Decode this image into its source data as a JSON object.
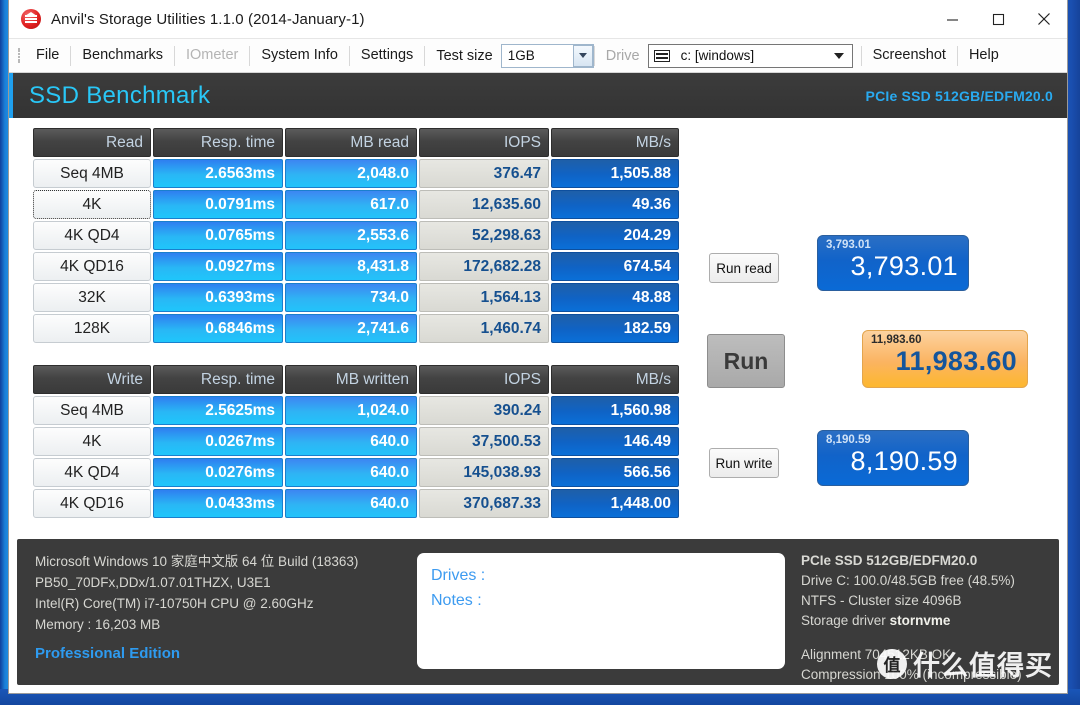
{
  "window": {
    "title": "Anvil's Storage Utilities 1.1.0 (2014-January-1)",
    "icon": "anvil-app-icon",
    "minimize": "minimize-icon",
    "maximize": "maximize-icon",
    "close": "close-icon"
  },
  "menu": {
    "items": [
      {
        "label": "File",
        "disabled": false
      },
      {
        "label": "Benchmarks",
        "disabled": false
      },
      {
        "label": "IOmeter",
        "disabled": true
      },
      {
        "label": "System Info",
        "disabled": false
      },
      {
        "label": "Settings",
        "disabled": false
      }
    ],
    "test_size_label": "Test size",
    "test_size_value": "1GB",
    "drive_label": "Drive",
    "drive_value": "c: [windows]",
    "screenshot_label": "Screenshot",
    "help_label": "Help"
  },
  "banner": {
    "title": "SSD Benchmark",
    "device": "PCIe SSD 512GB/EDFM20.0"
  },
  "read_table": {
    "headers": [
      "Read",
      "Resp. time",
      "MB read",
      "IOPS",
      "MB/s"
    ],
    "rows": [
      {
        "label": "Seq 4MB",
        "focus": false,
        "resp": "2.6563ms",
        "mb": "2,048.0",
        "iops": "376.47",
        "mbs": "1,505.88"
      },
      {
        "label": "4K",
        "focus": true,
        "resp": "0.0791ms",
        "mb": "617.0",
        "iops": "12,635.60",
        "mbs": "49.36"
      },
      {
        "label": "4K QD4",
        "focus": false,
        "resp": "0.0765ms",
        "mb": "2,553.6",
        "iops": "52,298.63",
        "mbs": "204.29"
      },
      {
        "label": "4K QD16",
        "focus": false,
        "resp": "0.0927ms",
        "mb": "8,431.8",
        "iops": "172,682.28",
        "mbs": "674.54"
      },
      {
        "label": "32K",
        "focus": false,
        "resp": "0.6393ms",
        "mb": "734.0",
        "iops": "1,564.13",
        "mbs": "48.88"
      },
      {
        "label": "128K",
        "focus": false,
        "resp": "0.6846ms",
        "mb": "2,741.6",
        "iops": "1,460.74",
        "mbs": "182.59"
      }
    ]
  },
  "write_table": {
    "headers": [
      "Write",
      "Resp. time",
      "MB written",
      "IOPS",
      "MB/s"
    ],
    "rows": [
      {
        "label": "Seq 4MB",
        "focus": false,
        "resp": "2.5625ms",
        "mb": "1,024.0",
        "iops": "390.24",
        "mbs": "1,560.98"
      },
      {
        "label": "4K",
        "focus": false,
        "resp": "0.0267ms",
        "mb": "640.0",
        "iops": "37,500.53",
        "mbs": "146.49"
      },
      {
        "label": "4K QD4",
        "focus": false,
        "resp": "0.0276ms",
        "mb": "640.0",
        "iops": "145,038.93",
        "mbs": "566.56"
      },
      {
        "label": "4K QD16",
        "focus": false,
        "resp": "0.0433ms",
        "mb": "640.0",
        "iops": "370,687.33",
        "mbs": "1,448.00"
      }
    ]
  },
  "controls": {
    "run_read": "Run read",
    "run": "Run",
    "run_write": "Run write"
  },
  "scores": {
    "read": {
      "mini": "3,793.01",
      "big": "3,793.01"
    },
    "total": {
      "mini": "11,983.60",
      "big": "11,983.60"
    },
    "write": {
      "mini": "8,190.59",
      "big": "8,190.59"
    }
  },
  "sysinfo": {
    "os": "Microsoft Windows 10 家庭中文版 64 位 Build (18363)",
    "board": "PB50_70DFx,DDx/1.07.01THZX, U3E1",
    "cpu": "Intel(R) Core(TM) i7-10750H CPU @ 2.60GHz",
    "memory": "Memory : 16,203 MB",
    "edition": "Professional Edition"
  },
  "notes": {
    "drives_label": "Drives :",
    "notes_label": "Notes :"
  },
  "driveinfo": {
    "device": "PCIe SSD 512GB/EDFM20.0",
    "capacity": "Drive C: 100.0/48.5GB free (48.5%)",
    "filesystem": "NTFS - Cluster size 4096B",
    "driver_label": "Storage driver",
    "driver_value": "stornvme",
    "alignment": "Alignment 704512KB OK",
    "compression": "Compression 100% (incompressible)"
  },
  "watermark": {
    "badge": "值",
    "text": "什么值得买"
  }
}
